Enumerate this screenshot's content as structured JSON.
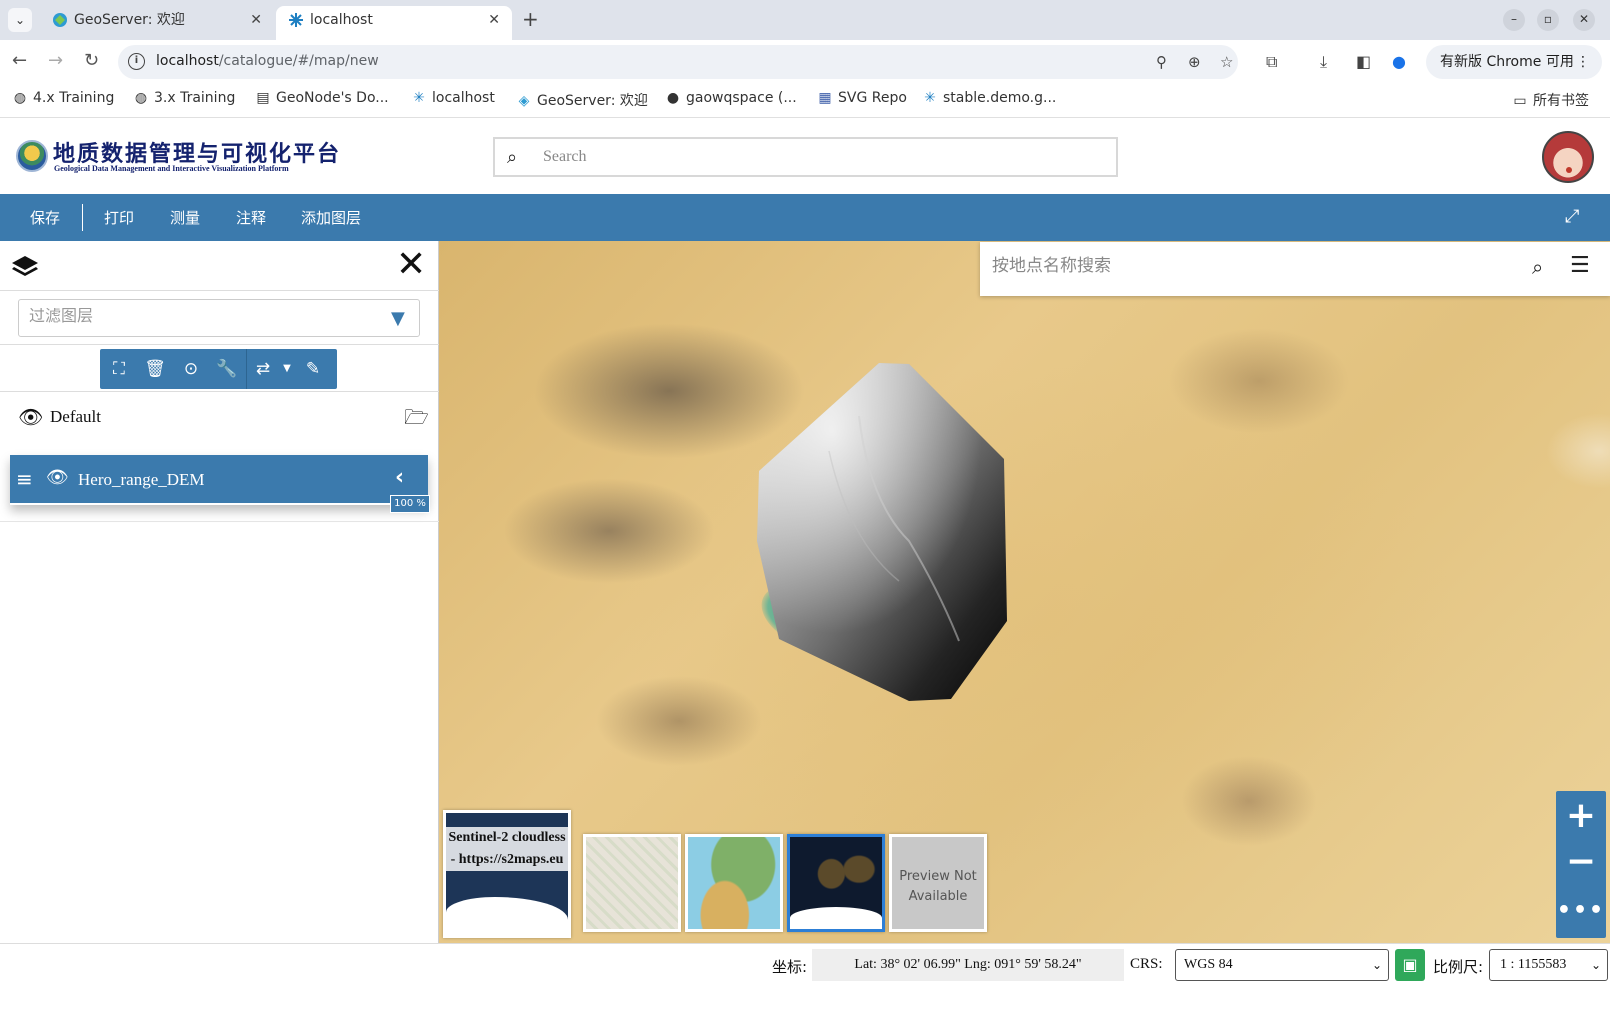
{
  "browser": {
    "tabs": [
      {
        "title": "GeoServer: 欢迎",
        "active": false
      },
      {
        "title": "localhost",
        "active": true
      }
    ],
    "new_tab": "+",
    "url_host": "localhost",
    "url_path": "/catalogue/#/map/new",
    "update_button": "有新版 Chrome 可用",
    "bookmarks": [
      {
        "label": "4.x Training",
        "icon": "globe-icon"
      },
      {
        "label": "3.x Training",
        "icon": "globe-icon"
      },
      {
        "label": "GeoNode's Do...",
        "icon": "doc-icon"
      },
      {
        "label": "localhost",
        "icon": "geonode-icon"
      },
      {
        "label": "GeoServer: 欢迎",
        "icon": "geoserver-icon"
      },
      {
        "label": "gaowqspace (...",
        "icon": "github-icon"
      },
      {
        "label": "SVG Repo",
        "icon": "svgrepo-icon"
      },
      {
        "label": "stable.demo.g...",
        "icon": "geonode-icon"
      }
    ],
    "all_bookmarks": "所有书签"
  },
  "app": {
    "title": "地质数据管理与可视化平台",
    "subtitle": "Geological Data Management and Interactive Visualization Platform",
    "search_placeholder": "Search"
  },
  "actions": [
    "保存",
    "打印",
    "测量",
    "注释",
    "添加图层"
  ],
  "toc": {
    "filter_placeholder": "过滤图层",
    "group": "Default",
    "layer": "Hero_range_DEM",
    "opacity": "100 %"
  },
  "map": {
    "place_search_placeholder": "按地点名称搜索",
    "backgrounds": {
      "main_label": "Sentinel-2 cloudless - https://s2maps.eu",
      "none_label": "Preview Not Available"
    }
  },
  "footer": {
    "coord_label": "坐标:",
    "coords": "Lat: 38° 02' 06.99\" Lng: 091° 59' 58.24\"",
    "crs_label": "CRS:",
    "crs": "WGS 84",
    "scale_label": "比例尺:",
    "scale": "1 : 1155583"
  },
  "colors": {
    "primary": "#3b7aad",
    "mouse_toggle": "#2fa85a"
  }
}
